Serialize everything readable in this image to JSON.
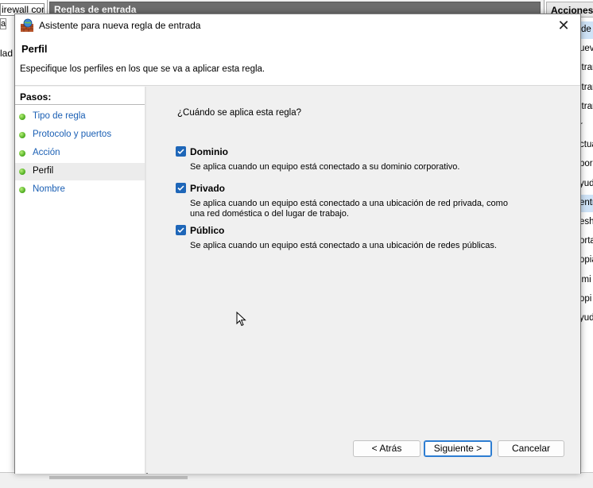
{
  "background": {
    "left_tree_text": "irewall cor",
    "left_row2": "a",
    "left_row3": "lad",
    "middle_header": "Reglas de entrada",
    "actions_header": "Acciones",
    "actions_items": [
      {
        "label": "de",
        "selected": true
      },
      {
        "label": "uev",
        "selected": false
      },
      {
        "label": "ltrar",
        "selected": false
      },
      {
        "label": "ltrar",
        "selected": false
      },
      {
        "label": "ltrar",
        "selected": false
      },
      {
        "label": "r",
        "selected": false
      },
      {
        "label": "ctua",
        "selected": false
      },
      {
        "label": "por",
        "selected": false
      },
      {
        "label": "yud",
        "selected": false
      },
      {
        "label": "entr",
        "selected": true
      },
      {
        "label": "esha",
        "selected": false
      },
      {
        "label": "orta",
        "selected": false
      },
      {
        "label": "opia",
        "selected": false
      },
      {
        "label": "imi",
        "selected": false
      },
      {
        "label": "opi",
        "selected": false
      },
      {
        "label": "yud",
        "selected": false
      }
    ]
  },
  "dialog": {
    "title": "Asistente para nueva regla de entrada",
    "close_icon": "close-icon",
    "header_title": "Perfil",
    "header_subtitle": "Especifique los perfiles en los que se va a aplicar esta regla.",
    "steps_title": "Pasos:",
    "steps": [
      {
        "label": "Tipo de regla",
        "current": false
      },
      {
        "label": "Protocolo y puertos",
        "current": false
      },
      {
        "label": "Acción",
        "current": false
      },
      {
        "label": "Perfil",
        "current": true
      },
      {
        "label": "Nombre",
        "current": false
      }
    ],
    "question": "¿Cuándo se aplica esta regla?",
    "options": [
      {
        "label": "Dominio",
        "checked": true,
        "description": "Se aplica cuando un equipo está conectado a su dominio corporativo."
      },
      {
        "label": "Privado",
        "checked": true,
        "description": "Se aplica cuando un equipo está conectado a una ubicación de red privada, como una red doméstica o del lugar de trabajo."
      },
      {
        "label": "Público",
        "checked": true,
        "description": "Se aplica cuando un equipo está conectado a una ubicación de redes públicas."
      }
    ],
    "buttons": {
      "back": "< Atrás",
      "next": "Siguiente >",
      "cancel": "Cancelar"
    }
  },
  "colors": {
    "accent": "#1e66b8",
    "link": "#1a5fb4",
    "step_dot": "#47a81b"
  }
}
